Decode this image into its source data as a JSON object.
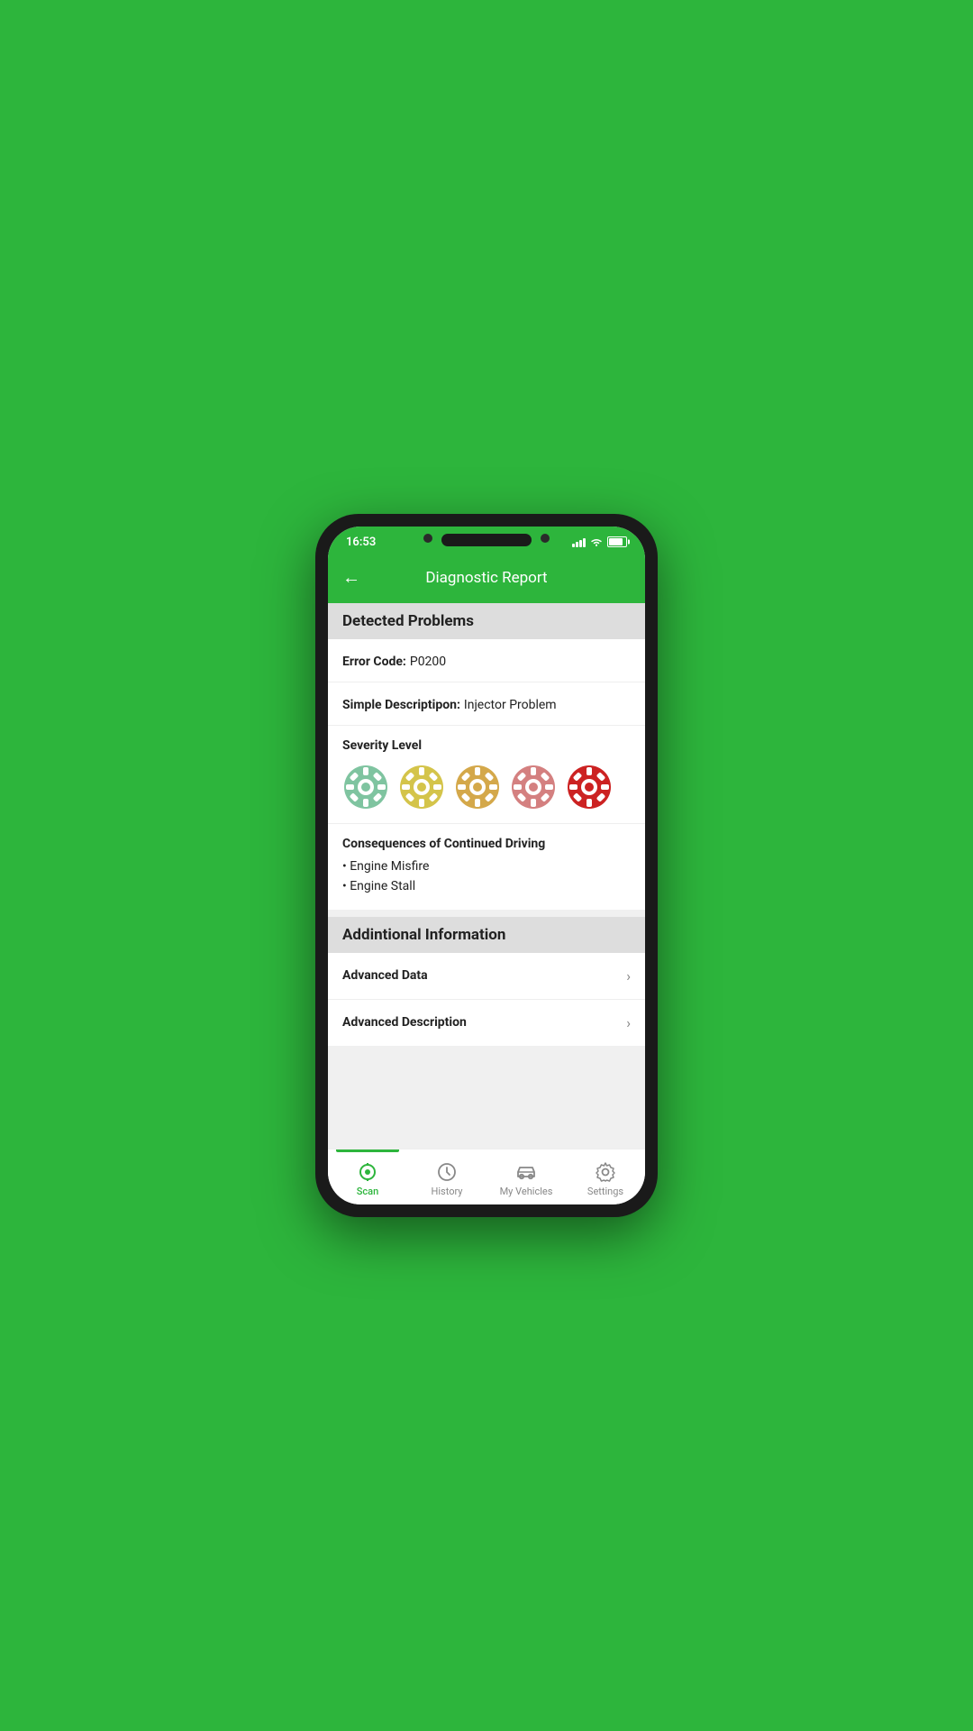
{
  "status_bar": {
    "time": "16:53"
  },
  "header": {
    "title": "Diagnostic Report",
    "back_label": "←"
  },
  "detected_problems": {
    "section_title": "Detected Problems",
    "error_code_label": "Error Code:",
    "error_code_value": "P0200",
    "simple_desc_label": "Simple Descriptipon:",
    "simple_desc_value": "Injector Problem",
    "severity_label": "Severity Level",
    "severity_count": 5,
    "consequences_label": "Consequences of Continued Driving",
    "consequences": [
      "Engine Misfire",
      "Engine Stall"
    ]
  },
  "additional_information": {
    "section_title": "Addintional Information",
    "rows": [
      {
        "label": "Advanced Data",
        "id": "advanced-data"
      },
      {
        "label": "Advanced Description",
        "id": "advanced-description"
      }
    ]
  },
  "nav": {
    "items": [
      {
        "id": "scan",
        "label": "Scan",
        "active": true
      },
      {
        "id": "history",
        "label": "History",
        "active": false
      },
      {
        "id": "my-vehicles",
        "label": "My Vehicles",
        "active": false
      },
      {
        "id": "settings",
        "label": "Settings",
        "active": false
      }
    ]
  },
  "severity_colors": [
    "#7fc4a0",
    "#d4b84a",
    "#d4a84a",
    "#d48080",
    "#cc2222"
  ],
  "accent_color": "#2db53c"
}
